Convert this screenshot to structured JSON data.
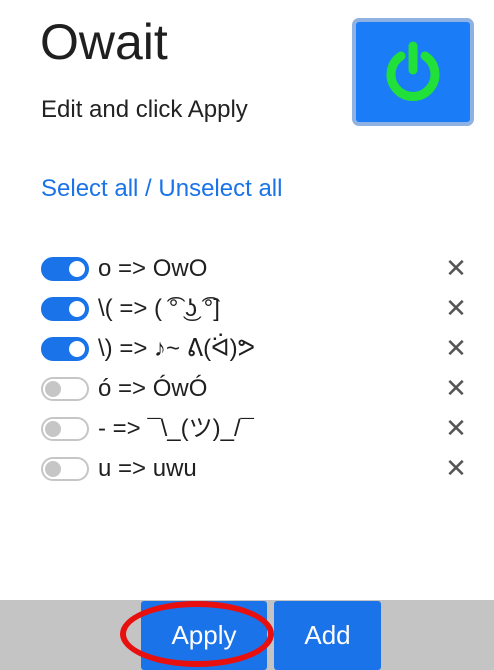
{
  "header": {
    "title": "Owait",
    "subtitle": "Edit and click Apply",
    "power_button_icon": "power-icon"
  },
  "selection": {
    "select_all": "Select all",
    "separator": " / ",
    "unselect_all": "Unselect all"
  },
  "rules": [
    {
      "text": "o => OwO",
      "enabled": true
    },
    {
      "text": "\\( => ( ͡° ͜ʖ ͡°]",
      "enabled": true
    },
    {
      "text": "\\) => ♪~ ᕕ(ᐛ)ᕗ",
      "enabled": true
    },
    {
      "text": "ó => ÓwÓ",
      "enabled": false
    },
    {
      "text": "- => ¯\\_(ツ)_/¯",
      "enabled": false
    },
    {
      "text": "u => uwu",
      "enabled": false
    }
  ],
  "delete_glyph": "✕",
  "footer": {
    "apply_label": "Apply",
    "add_label": "Add"
  },
  "colors": {
    "accent": "#1a73e8",
    "power_icon": "#22e03a",
    "highlight": "#e80f0f",
    "footer_bg": "#c4c4c4"
  }
}
